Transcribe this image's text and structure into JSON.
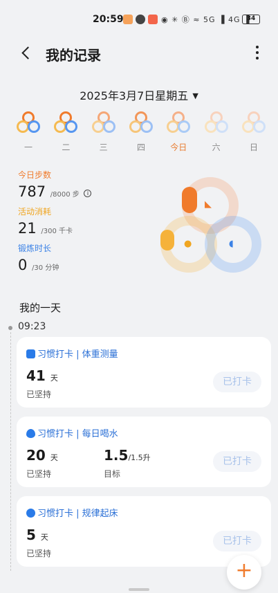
{
  "status": {
    "time": "20:59",
    "battery": "34",
    "signal": "◉ ✳ Ⓑ ≈ 5G ▐ 4G ▐"
  },
  "header": {
    "title": "我的记录"
  },
  "date": {
    "label": "2025年3月7日星期五",
    "caret": "▼"
  },
  "week": [
    {
      "label": "一"
    },
    {
      "label": "二"
    },
    {
      "label": "三"
    },
    {
      "label": "四"
    },
    {
      "label": "今日"
    },
    {
      "label": "六"
    },
    {
      "label": "日"
    }
  ],
  "stats": {
    "steps": {
      "label": "今日步数",
      "value": "787",
      "goal": "/8000 步",
      "info": "i"
    },
    "calories": {
      "label": "活动消耗",
      "value": "21",
      "goal": "/300 千卡"
    },
    "exercise": {
      "label": "锻炼时长",
      "value": "0",
      "goal": "/30 分钟"
    }
  },
  "day": {
    "title": "我的一天",
    "time": "09:23"
  },
  "cards": [
    {
      "title": "习惯打卡 | 体重测量",
      "value": "41",
      "unit": "天",
      "sub": "已坚持",
      "button": "已打卡"
    },
    {
      "title": "习惯打卡 | 每日喝水",
      "value": "20",
      "unit": "天",
      "sub": "已坚持",
      "value2": "1.5",
      "unit2": "/1.5升",
      "sub2": "目标",
      "button": "已打卡"
    },
    {
      "title": "习惯打卡 | 规律起床",
      "value": "5",
      "unit": "天",
      "sub": "已坚持",
      "button": "已打卡"
    }
  ],
  "fab": {
    "label": "+"
  },
  "colors": {
    "orange": "#f07b2c",
    "yellow": "#f5ba50",
    "blue": "#5696f0",
    "link_blue": "#2a6fd6"
  }
}
